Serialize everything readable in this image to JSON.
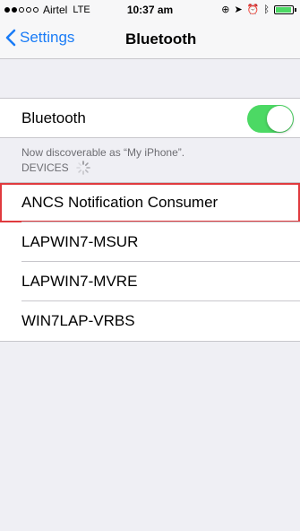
{
  "status_bar": {
    "carrier": "Airtel",
    "network": "LTE",
    "time": "10:37 am"
  },
  "nav": {
    "back_label": "Settings",
    "title": "Bluetooth"
  },
  "bluetooth_toggle": {
    "label": "Bluetooth",
    "state": "on",
    "accent": "#4cd964"
  },
  "discoverable_note": "Now discoverable as “My iPhone”.",
  "devices": {
    "header": "DEVICES",
    "items": [
      {
        "name": "ANCS Notification Consumer",
        "highlighted": true
      },
      {
        "name": "LAPWIN7-MSUR"
      },
      {
        "name": "LAPWIN7-MVRE"
      },
      {
        "name": "WIN7LAP-VRBS"
      }
    ]
  },
  "colors": {
    "background": "#efeff4",
    "link_blue": "#1a7cf6",
    "highlight_red": "#e03a3e"
  }
}
